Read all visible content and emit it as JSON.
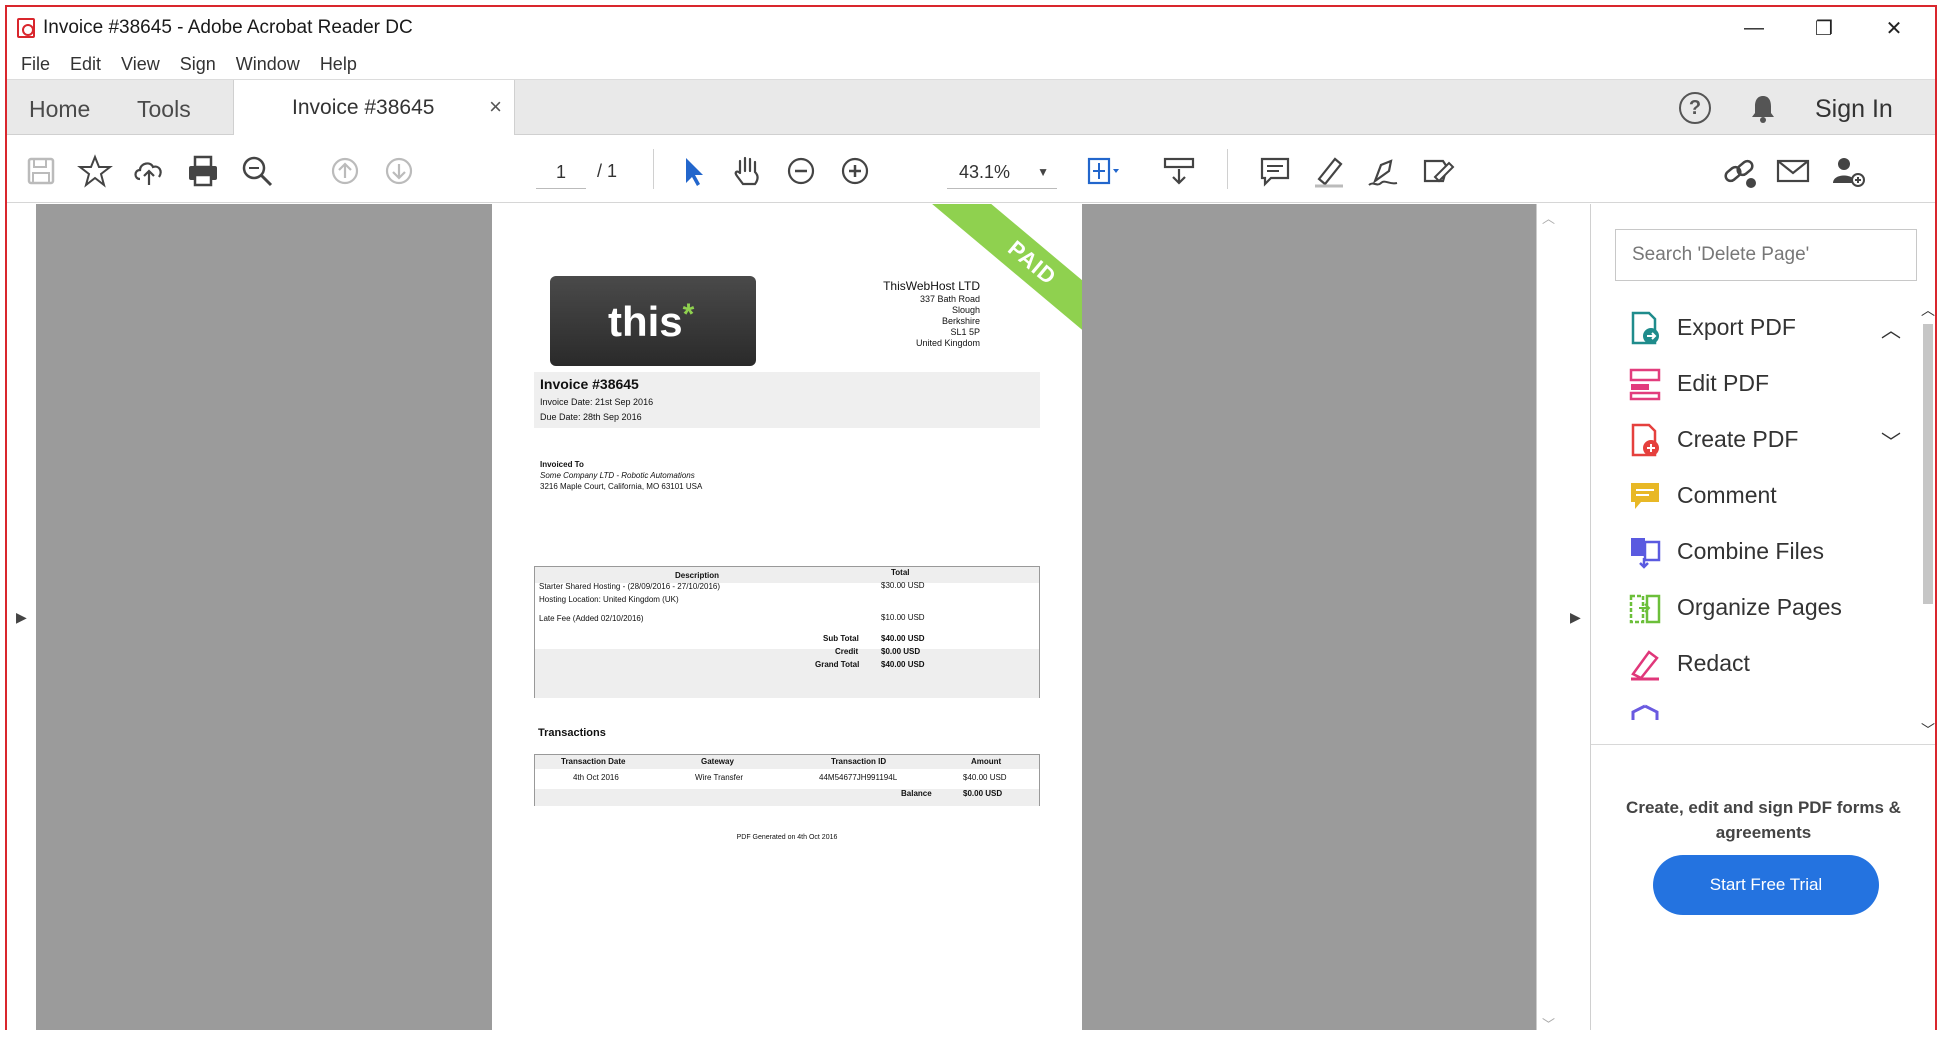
{
  "window": {
    "title": "Invoice #38645 - Adobe Acrobat Reader DC",
    "controls": {
      "minimize": "—",
      "restore": "❐",
      "close": "✕"
    }
  },
  "menu": [
    "File",
    "Edit",
    "View",
    "Sign",
    "Window",
    "Help"
  ],
  "tabs": {
    "home": "Home",
    "tools": "Tools",
    "document": "Invoice #38645",
    "close_symbol": "×"
  },
  "header_right": {
    "help": "?",
    "sign_in": "Sign In"
  },
  "toolbar": {
    "icons": [
      "save-icon",
      "bookmark-star-icon",
      "upload-cloud-icon",
      "print-icon",
      "search-zoom-icon",
      "page-up-icon",
      "page-down-icon",
      "select-cursor-icon",
      "hand-icon",
      "zoom-out-icon",
      "zoom-in-icon",
      "fit-page-icon",
      "scroll-mode-icon",
      "comment-icon",
      "highlight-icon",
      "sign-icon",
      "fill-sign-icon",
      "share-link-icon",
      "email-icon",
      "add-user-icon"
    ],
    "page_current": "1",
    "page_total": "/ 1",
    "zoom": "43.1%"
  },
  "document": {
    "paid_ribbon": "PAID",
    "logo_text": "this",
    "logo_mark": "*",
    "company": {
      "name": "ThisWebHost LTD",
      "lines": [
        "337 Bath Road",
        "Slough",
        "Berkshire",
        "SL1 5P",
        "United Kingdom"
      ]
    },
    "invoice": {
      "title": "Invoice #38645",
      "date": "Invoice Date: 21st Sep 2016",
      "due": "Due Date: 28th Sep 2016"
    },
    "invoiced_to": {
      "heading": "Invoiced To",
      "company": "Some Company LTD - Robotic Automations",
      "address": "3216 Maple Court,   California, MO 63101 USA"
    },
    "items_table": {
      "headers": [
        "Description",
        "Total"
      ],
      "rows": [
        {
          "desc": "Starter Shared Hosting - (28/09/2016 - 27/10/2016)",
          "total": "$30.00 USD"
        },
        {
          "desc": "Hosting Location: United Kingdom (UK)",
          "total": ""
        },
        {
          "desc": "Late Fee (Added 02/10/2016)",
          "total": "$10.00 USD"
        }
      ],
      "summary": [
        {
          "label": "Sub Total",
          "value": "$40.00 USD"
        },
        {
          "label": "Credit",
          "value": "$0.00 USD"
        },
        {
          "label": "Grand Total",
          "value": "$40.00 USD"
        }
      ]
    },
    "transactions": {
      "title": "Transactions",
      "headers": [
        "Transaction Date",
        "Gateway",
        "Transaction ID",
        "Amount"
      ],
      "row": [
        "4th Oct 2016",
        "Wire Transfer",
        "44M54677JH991194L",
        "$40.00 USD"
      ],
      "balance_label": "Balance",
      "balance_value": "$0.00 USD"
    },
    "footer": "PDF Generated on 4th Oct 2016"
  },
  "right_pane": {
    "search_placeholder": "Search 'Delete Page'",
    "tools": [
      {
        "label": "Export PDF",
        "color": "#1f8c8c"
      },
      {
        "label": "Edit PDF",
        "color": "#e23d7d"
      },
      {
        "label": "Create PDF",
        "color": "#e5403d"
      },
      {
        "label": "Comment",
        "color": "#e8b826"
      },
      {
        "label": "Combine Files",
        "color": "#5a5ae0"
      },
      {
        "label": "Organize Pages",
        "color": "#6cbf3a"
      },
      {
        "label": "Redact",
        "color": "#e0377a"
      }
    ],
    "promo_text": "Create, edit and sign PDF forms & agreements",
    "promo_button": "Start Free Trial"
  }
}
